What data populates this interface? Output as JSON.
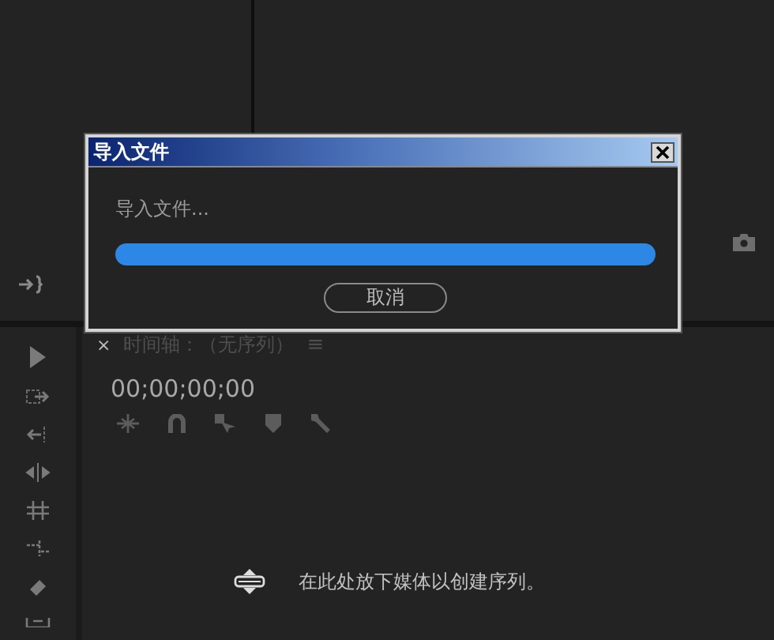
{
  "dialog": {
    "title": "导入文件",
    "message": "导入文件...",
    "buttons": [
      "取消"
    ]
  },
  "timeline": {
    "tab_close": "×",
    "title": "时间轴：（无序列）",
    "menu": "≡",
    "timecode": "00;00;00;00",
    "hint": "在此处放下媒体以创建序列。"
  }
}
